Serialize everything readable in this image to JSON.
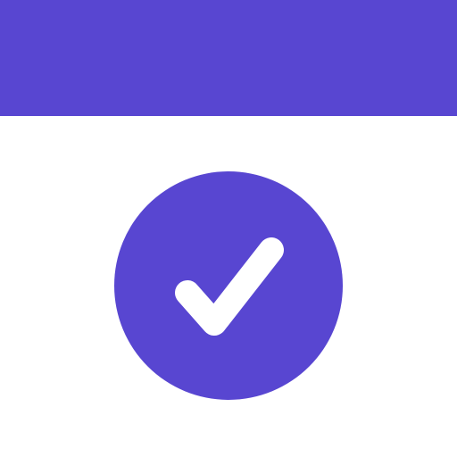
{
  "colors": {
    "accent": "#5846D1",
    "background": "#FFFFFF",
    "icon_foreground": "#FFFFFF"
  },
  "icons": {
    "status": "check-circle-icon"
  }
}
